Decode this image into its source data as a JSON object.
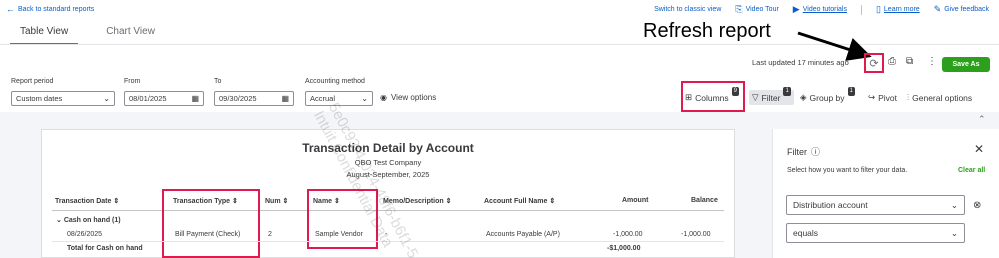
{
  "nav": {
    "back_label": "Back to standard reports"
  },
  "toplinks": {
    "switch_classic": "Switch to classic view",
    "video_tour": "Video Tour",
    "video_tutorials": "Video tutorials",
    "learn_more": "Learn more",
    "give_feedback": "Give feedback"
  },
  "tabs": [
    {
      "label": "Table View",
      "active": true
    },
    {
      "label": "Chart View",
      "active": false
    }
  ],
  "annotation": {
    "text": "Refresh report"
  },
  "toolbar": {
    "last_updated": "Last updated 17 minutes ago",
    "save_label": "Save As"
  },
  "filters": {
    "period_label": "Report period",
    "period_value": "Custom dates",
    "from_label": "From",
    "from_value": "08/01/2025",
    "to_label": "To",
    "to_value": "09/30/2025",
    "method_label": "Accounting method",
    "method_value": "Accrual",
    "view_options": "View options"
  },
  "tools": {
    "columns": "Columns",
    "columns_badge": "9",
    "filter": "Filter",
    "filter_badge": "1",
    "group_by": "Group by",
    "group_badge": "1",
    "pivot": "Pivot",
    "general_options": "General options"
  },
  "report": {
    "title": "Transaction Detail by Account",
    "company": "QBO Test Company",
    "period": "August-September, 2025",
    "columns": [
      "Transaction Date",
      "Transaction Type",
      "Num",
      "Name",
      "Memo/Description",
      "Account Full Name",
      "Amount",
      "Balance"
    ],
    "group": {
      "label": "Cash on hand (1)"
    },
    "rows": [
      {
        "date": "08/26/2025",
        "type": "Bill Payment (Check)",
        "num": "2",
        "name": "Sample Vendor",
        "memo": "-",
        "account": "Accounts Payable (A/P)",
        "amount": "-1,000.00",
        "balance": "-1,000.00"
      }
    ],
    "total": {
      "label": "Total for Cash on hand",
      "amount": "-$1,000.00"
    }
  },
  "filter_panel": {
    "title": "Filter",
    "description": "Select how you want to filter your data.",
    "clear_all": "Clear all",
    "field_value": "Distribution account",
    "operator_value": "equals"
  },
  "watermark": {
    "text": "5e0c93f4-024-48f6-b6f1-5",
    "line2": "Intuit Confidential Data"
  },
  "colors": {
    "accent": "#2ca01c",
    "link": "#0b5ec9",
    "highlight": "#e01a4f"
  }
}
